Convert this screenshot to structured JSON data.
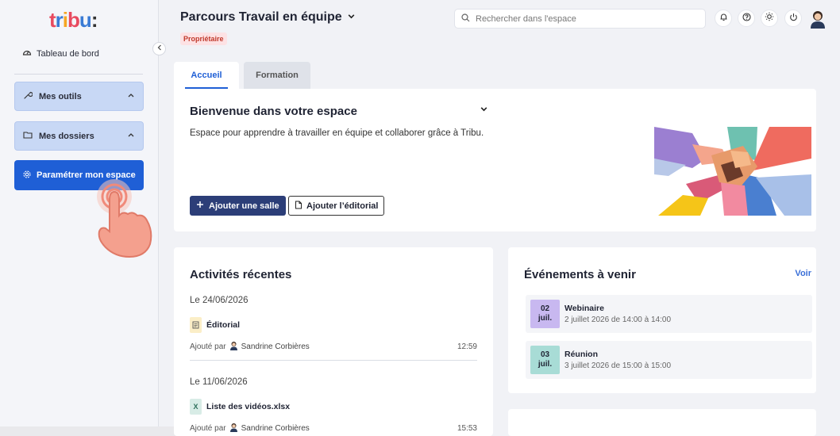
{
  "brand": {
    "logo_text": "tribu:"
  },
  "sidebar": {
    "dashboard_label": "Tableau de bord",
    "groups": [
      {
        "label": "Mes outils"
      },
      {
        "label": "Mes dossiers"
      }
    ],
    "settings_button": "Paramétrer mon espace"
  },
  "header": {
    "space_title": "Parcours Travail en équipe",
    "role_badge": "Propriétaire",
    "search_placeholder": "Rechercher dans l'espace"
  },
  "tabs": [
    {
      "label": "Accueil",
      "active": true
    },
    {
      "label": "Formation",
      "active": false
    }
  ],
  "welcome": {
    "title": "Bienvenue dans votre espace",
    "description": "Espace pour apprendre à travailler en équipe et collaborer grâce à Tribu.",
    "add_room_button": "Ajouter une salle",
    "add_editorial_button": "Ajouter l’éditorial"
  },
  "recent": {
    "title": "Activités récentes",
    "entries": [
      {
        "date": "Le 24/06/2026",
        "item": "Éditorial",
        "icon": "document-icon",
        "added_by_label": "Ajouté par",
        "author": "Sandrine Corbières",
        "time": "12:59"
      },
      {
        "date": "Le 11/06/2026",
        "item": "Liste des vidéos.xlsx",
        "icon": "spreadsheet-icon",
        "icon_letter": "X",
        "added_by_label": "Ajouté par",
        "author": "Sandrine Corbières",
        "time": "15:53"
      }
    ]
  },
  "events": {
    "title": "Événements à venir",
    "see_all": "Voir",
    "items": [
      {
        "day": "02",
        "month": "juil.",
        "name": "Webinaire",
        "when": "2 juillet 2026 de 14:00 à 14:00",
        "color": "#c8b8f0"
      },
      {
        "day": "03",
        "month": "juil.",
        "name": "Réunion",
        "when": "3 juillet 2026 de 15:00 à 15:00",
        "color": "#a8dcd6"
      }
    ]
  },
  "colors": {
    "primary": "#1f5fd6",
    "dark_button": "#2c3e78",
    "badge_bg": "#fde2e4",
    "badge_text": "#c0392b",
    "link": "#3a6fd8"
  }
}
